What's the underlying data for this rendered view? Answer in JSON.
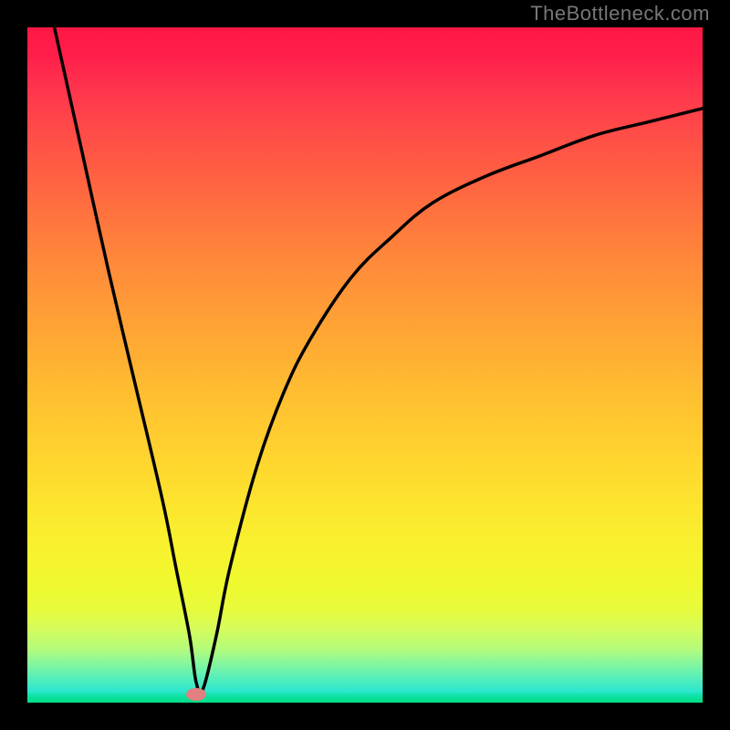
{
  "watermark": "TheBottleneck.com",
  "chart_data": {
    "type": "line",
    "title": "",
    "xlabel": "",
    "ylabel": "",
    "xlim": [
      0,
      100
    ],
    "ylim": [
      0,
      100
    ],
    "grid": false,
    "legend": false,
    "series": [
      {
        "name": "bottleneck-curve",
        "x": [
          4,
          8,
          12,
          16,
          20,
          22,
          24,
          25,
          26,
          28,
          30,
          34,
          38,
          42,
          48,
          54,
          60,
          68,
          76,
          84,
          92,
          100
        ],
        "values": [
          100,
          82,
          64,
          47,
          30,
          20,
          10,
          3,
          2,
          10,
          20,
          35,
          46,
          54,
          63,
          69,
          74,
          78,
          81,
          84,
          86,
          88
        ]
      }
    ],
    "marker": {
      "x": 25,
      "y": 1.2
    },
    "gradient_stops": [
      {
        "pos": 0,
        "color": "#ff1744"
      },
      {
        "pos": 50,
        "color": "#ffb030"
      },
      {
        "pos": 80,
        "color": "#f7f32e"
      },
      {
        "pos": 100,
        "color": "#10e0da"
      }
    ]
  }
}
